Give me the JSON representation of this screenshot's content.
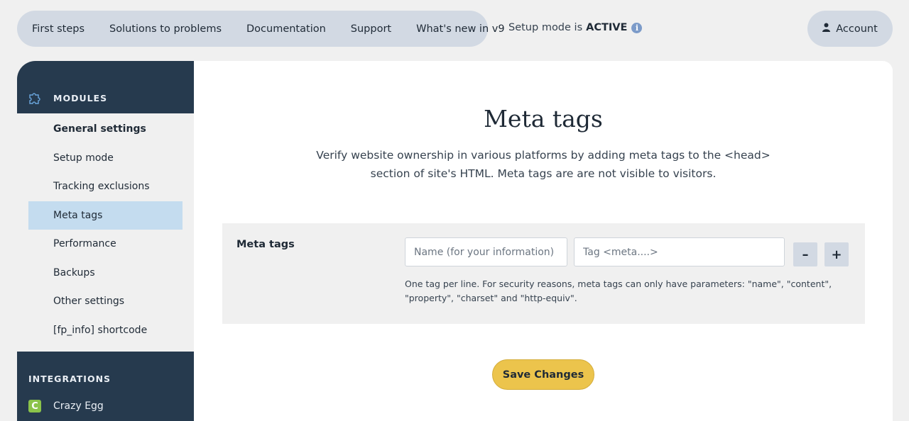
{
  "topnav": {
    "items": [
      "First steps",
      "Solutions to problems",
      "Documentation",
      "Support",
      "What's new in v9"
    ]
  },
  "setup_status": {
    "prefix": "Setup mode is",
    "value": "ACTIVE",
    "info_icon": "i"
  },
  "account": {
    "label": "Account",
    "icon": "user-icon"
  },
  "sidebar": {
    "modules_heading": "MODULES",
    "items": [
      {
        "label": "General settings",
        "state": "bold"
      },
      {
        "label": "Setup mode",
        "state": ""
      },
      {
        "label": "Tracking exclusions",
        "state": ""
      },
      {
        "label": "Meta tags",
        "state": "active"
      },
      {
        "label": "Performance",
        "state": ""
      },
      {
        "label": "Backups",
        "state": ""
      },
      {
        "label": "Other settings",
        "state": ""
      },
      {
        "label": "[fp_info] shortcode",
        "state": ""
      }
    ],
    "integrations_heading": "INTEGRATIONS",
    "integrations": [
      {
        "label": "Crazy Egg",
        "icon_letter": "C",
        "icon_color": "#8bc34a"
      }
    ]
  },
  "main": {
    "title": "Meta tags",
    "description": "Verify website ownership in various platforms by adding meta tags to the <head> section of site's HTML. Meta tags are are not visible to visitors.",
    "field_label": "Meta tags",
    "name_placeholder": "Name (for your information)",
    "tag_placeholder": "Tag <meta....>",
    "minus_label": "–",
    "plus_label": "+",
    "help_text": "One tag per line. For security reasons, meta tags can only have parameters: \"name\", \"content\", \"property\", \"charset\" and \"http-equiv\".",
    "save_label": "Save Changes"
  },
  "colors": {
    "nav_bg": "#d2d9e3",
    "sidebar_dark": "#263a4e",
    "active_item": "#c4dcef",
    "save_button": "#ecc44c"
  }
}
